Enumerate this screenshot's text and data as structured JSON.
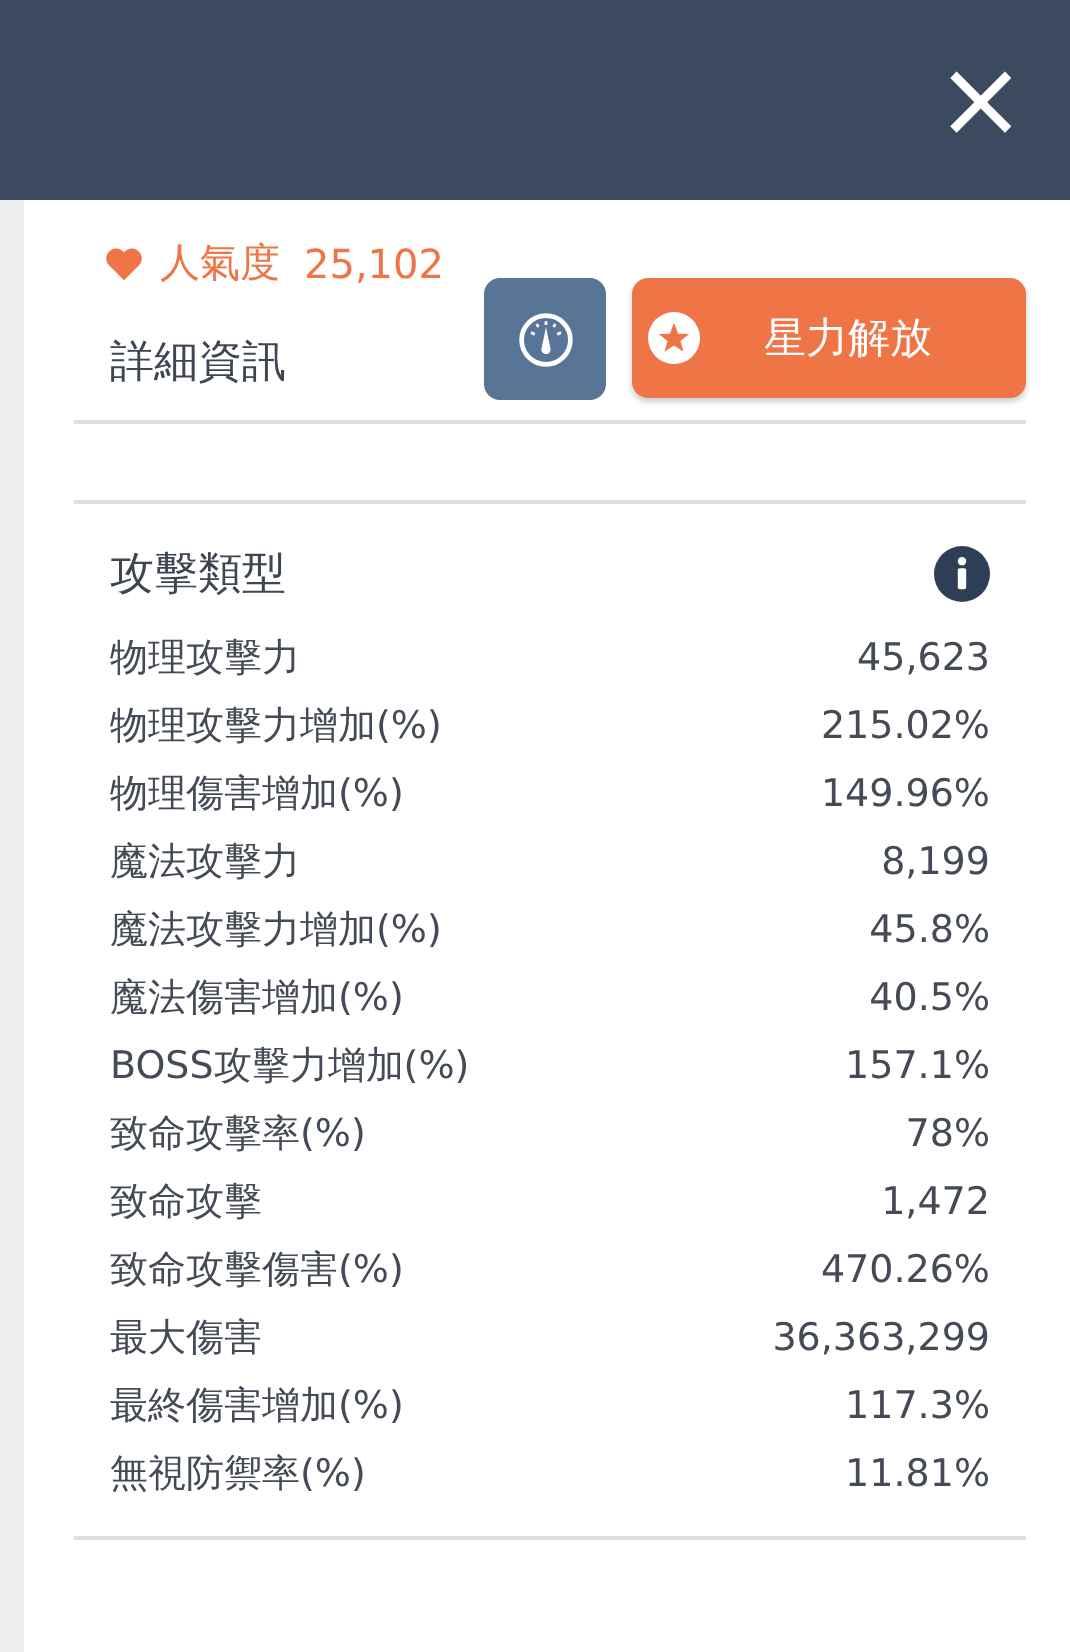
{
  "header": {
    "close": "×"
  },
  "popularity": {
    "label": "人氣度",
    "value": "25,102"
  },
  "section_title": "詳細資訊",
  "star_button": {
    "label": "星力解放"
  },
  "attack": {
    "title": "攻擊類型",
    "stats": [
      {
        "label": "物理攻擊力",
        "value": "45,623"
      },
      {
        "label": "物理攻擊力增加(%)",
        "value": "215.02%"
      },
      {
        "label": "物理傷害增加(%)",
        "value": "149.96%"
      },
      {
        "label": "魔法攻擊力",
        "value": "8,199"
      },
      {
        "label": "魔法攻擊力增加(%)",
        "value": "45.8%"
      },
      {
        "label": "魔法傷害增加(%)",
        "value": "40.5%"
      },
      {
        "label": "BOSS攻擊力增加(%)",
        "value": "157.1%"
      },
      {
        "label": "致命攻擊率(%)",
        "value": "78%"
      },
      {
        "label": "致命攻擊",
        "value": "1,472"
      },
      {
        "label": "致命攻擊傷害(%)",
        "value": "470.26%"
      },
      {
        "label": "最大傷害",
        "value": "36,363,299"
      },
      {
        "label": "最終傷害增加(%)",
        "value": "117.3%"
      },
      {
        "label": "無視防禦率(%)",
        "value": "11.81%"
      }
    ]
  }
}
